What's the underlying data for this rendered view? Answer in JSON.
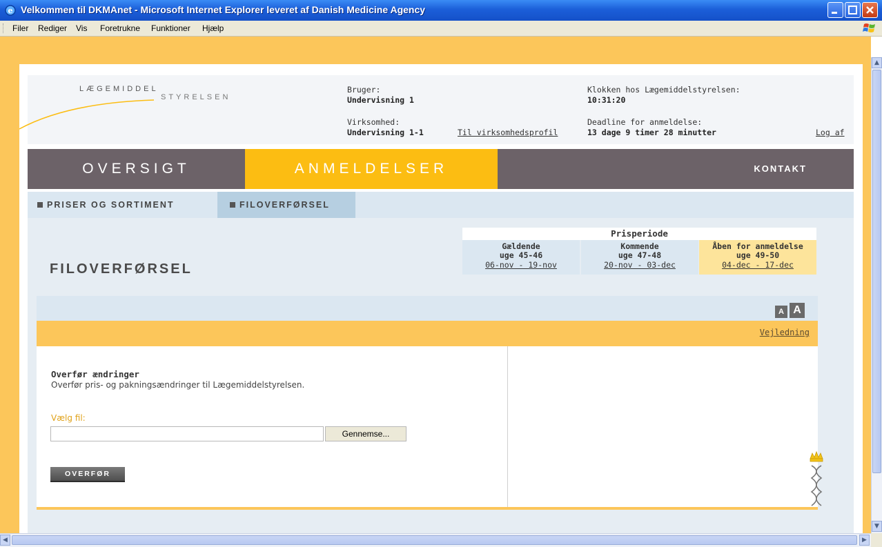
{
  "window": {
    "title": "Velkommen til DKMAnet - Microsoft Internet Explorer leveret af Danish Medicine Agency"
  },
  "menu": {
    "items": [
      "Filer",
      "Rediger",
      "Vis",
      "Foretrukne",
      "Funktioner",
      "Hjælp"
    ]
  },
  "logo": {
    "line1": "LÆGEMIDDEL",
    "line2": "STYRELSEN"
  },
  "user": {
    "bruger_label": "Bruger:",
    "bruger_value": "Undervisning 1",
    "virksomhed_label": "Virksomhed:",
    "virksomhed_value": "Undervisning 1-1",
    "profile_link": "Til virksomhedsprofil"
  },
  "clock": {
    "label": "Klokken hos Lægemiddelstyrelsen:",
    "value": "10:31:20",
    "deadline_label": "Deadline for anmeldelse:",
    "deadline_value": "13 dage 9 timer 28 minutter",
    "logout": "Log af"
  },
  "nav": {
    "tabs": [
      "OVERSIGT",
      "ANMELDELSER"
    ],
    "contact": "KONTAKT"
  },
  "subnav": {
    "tabs": [
      "PRISER OG SORTIMENT",
      "FILOVERFØRSEL"
    ]
  },
  "page": {
    "title": "FILOVERFØRSEL"
  },
  "period": {
    "heading": "Prisperiode",
    "columns": [
      {
        "title": "Gældende",
        "weeks": "uge 45-46",
        "dates": "06-nov - 19-nov"
      },
      {
        "title": "Kommende",
        "weeks": "uge 47-48",
        "dates": "20-nov - 03-dec"
      },
      {
        "title": "Åben for anmeldelse",
        "weeks": "uge 49-50",
        "dates": "04-dec - 17-dec"
      }
    ]
  },
  "fontsize": {
    "small": "A",
    "large": "A"
  },
  "help": {
    "link": "Vejledning"
  },
  "upload": {
    "title": "Overfør ændringer",
    "description": "Overfør pris- og pakningsændringer til Lægemiddelstyrelsen.",
    "file_label": "Vælg fil:",
    "file_value": "",
    "browse_label": "Gennemse...",
    "submit_label": "OVERFØR"
  },
  "colors": {
    "accent": "#fcbd12",
    "nav_bg": "#6c6268",
    "frame": "#fcc65a",
    "light_blue": "#dbe7f1"
  }
}
